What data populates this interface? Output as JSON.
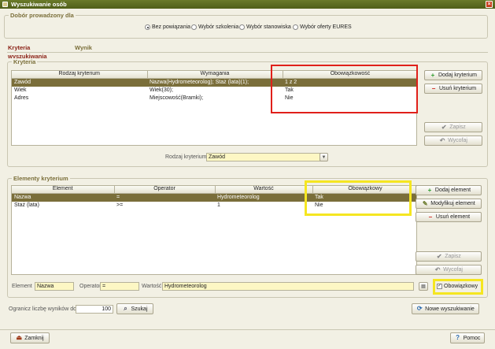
{
  "window": {
    "title": "Wyszukiwanie osób"
  },
  "selection_group": {
    "title": "Dobór prowadzony dla",
    "options": [
      {
        "label": "Bez powiązania",
        "selected": true
      },
      {
        "label": "Wybór szkolenia",
        "selected": false
      },
      {
        "label": "Wybór stanowiska",
        "selected": false
      },
      {
        "label": "Wybór oferty EURES",
        "selected": false
      }
    ]
  },
  "tabs": [
    {
      "label": "Kryteria wyszukiwania",
      "active": true
    },
    {
      "label": "Wynik",
      "active": false
    }
  ],
  "criteria": {
    "title": "Kryteria",
    "columns": [
      "Rodzaj kryterium",
      "Wymagania",
      "Obowiązkowość"
    ],
    "rows": [
      {
        "cells": [
          "Zawód",
          "Nazwa(Hydrometeorolog); Staż (lata)(1);",
          "1 z 2"
        ],
        "selected": true
      },
      {
        "cells": [
          "Wiek",
          "Wiek(30);",
          "Tak"
        ],
        "selected": false
      },
      {
        "cells": [
          "Adres",
          "Miejscowość(Bramki);",
          "Nie"
        ],
        "selected": false
      }
    ],
    "buttons": {
      "add": "Dodaj kryterium",
      "remove": "Usuń kryterium",
      "save": "Zapisz",
      "undo": "Wycofaj"
    },
    "type_label": "Rodzaj kryterium",
    "type_value": "Zawód"
  },
  "elements": {
    "title": "Elementy kryterium",
    "columns": [
      "Element",
      "Operator",
      "Wartość",
      "Obowiązkowy"
    ],
    "rows": [
      {
        "cells": [
          "Nazwa",
          "=",
          "Hydrometeorolog",
          "Tak"
        ],
        "selected": true
      },
      {
        "cells": [
          "Staż (lata)",
          ">=",
          "1",
          "Nie"
        ],
        "selected": false
      }
    ],
    "buttons": {
      "add": "Dodaj element",
      "modify": "Modyfikuj element",
      "remove": "Usuń element",
      "save": "Zapisz",
      "undo": "Wycofaj"
    },
    "editor": {
      "element_label": "Element",
      "element_value": "Nazwa",
      "operator_label": "Operator",
      "operator_value": "=",
      "value_label": "Wartość",
      "value_value": "Hydrometeorolog",
      "mandatory_label": "Obowiązkowy",
      "mandatory_checked": true
    }
  },
  "limit": {
    "label": "Ogranicz liczbę wyników do",
    "value": "100",
    "search_button": "Szukaj",
    "new_search_button": "Nowe wyszukiwanie"
  },
  "footer": {
    "close_button": "Zamknij",
    "help_button": "Pomoc"
  },
  "colors": {
    "title_bar": "#56651c",
    "selected_row": "#7a6e3a",
    "highlight_red": "#e0201a",
    "highlight_yellow": "#f5e621",
    "active_tab": "#8a1f14"
  }
}
